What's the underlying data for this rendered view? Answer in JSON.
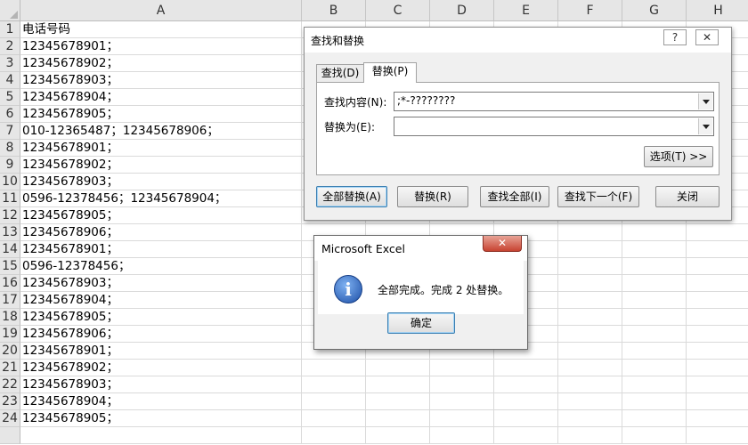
{
  "columns": [
    "A",
    "B",
    "C",
    "D",
    "E",
    "F",
    "G",
    "H"
  ],
  "rows": [
    {
      "num": "1",
      "a": "电话号码"
    },
    {
      "num": "2",
      "a": "12345678901；"
    },
    {
      "num": "3",
      "a": "12345678902；"
    },
    {
      "num": "4",
      "a": "12345678903；"
    },
    {
      "num": "5",
      "a": "12345678904；"
    },
    {
      "num": "6",
      "a": "12345678905；"
    },
    {
      "num": "7",
      "a": "010-12365487；12345678906；"
    },
    {
      "num": "8",
      "a": "12345678901；"
    },
    {
      "num": "9",
      "a": "12345678902；"
    },
    {
      "num": "10",
      "a": "12345678903；"
    },
    {
      "num": "11",
      "a": "0596-12378456；12345678904；"
    },
    {
      "num": "12",
      "a": "12345678905；"
    },
    {
      "num": "13",
      "a": "12345678906；"
    },
    {
      "num": "14",
      "a": "12345678901；"
    },
    {
      "num": "15",
      "a": "0596-12378456；"
    },
    {
      "num": "16",
      "a": "12345678903；"
    },
    {
      "num": "17",
      "a": "12345678904；"
    },
    {
      "num": "18",
      "a": "12345678905；"
    },
    {
      "num": "19",
      "a": "12345678906；"
    },
    {
      "num": "20",
      "a": "12345678901；"
    },
    {
      "num": "21",
      "a": "12345678902；"
    },
    {
      "num": "22",
      "a": "12345678903；"
    },
    {
      "num": "23",
      "a": "12345678904；"
    },
    {
      "num": "24",
      "a": "12345678905；"
    }
  ],
  "find_dialog": {
    "title": "查找和替换",
    "help_label": "?",
    "close_label": "✕",
    "tab_find": "查找(D)",
    "tab_replace": "替换(P)",
    "find_label": "查找内容(N):",
    "find_value": ";*-????????",
    "replace_label": "替换为(E):",
    "replace_value": "",
    "options_label": "选项(T) >>",
    "replace_all_label": "全部替换(A)",
    "replace_label_btn": "替换(R)",
    "find_all_label": "查找全部(I)",
    "find_next_label": "查找下一个(F)",
    "close_btn_label": "关闭"
  },
  "message_box": {
    "title": "Microsoft Excel",
    "close_label": "✕",
    "icon": "info-icon",
    "text": "全部完成。完成 2 处替换。",
    "ok_label": "确定"
  }
}
